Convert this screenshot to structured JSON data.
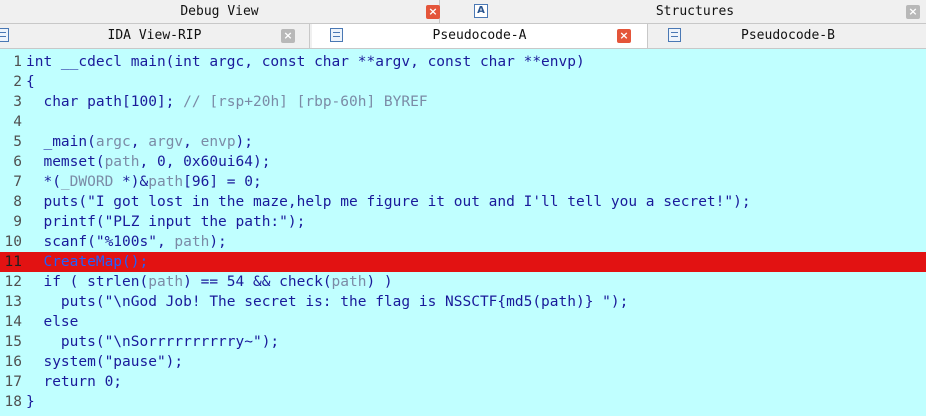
{
  "tabs_top": [
    {
      "label": "Debug View",
      "active": false
    },
    {
      "label": "Structures",
      "active": false
    }
  ],
  "tabs_bottom": [
    {
      "label": "IDA View-RIP",
      "active": false
    },
    {
      "label": "Pseudocode-A",
      "active": true
    },
    {
      "label": "Pseudocode-B",
      "active": false
    }
  ],
  "breakpoint_line": 11,
  "colors": {
    "background": "#c0ffff",
    "breakpoint": "#e21212",
    "code": "#1a1a9a",
    "variable": "#7b8ba6"
  },
  "code_lines": [
    [
      [
        "int __cdecl main(int argc, const char **argv, const char **envp)",
        "c"
      ]
    ],
    [
      [
        "{",
        "c"
      ]
    ],
    [
      [
        "  char path[100]; ",
        "c"
      ],
      [
        "// [rsp+20h] [rbp-60h] BYREF",
        "m"
      ]
    ],
    [
      [
        "",
        "c"
      ]
    ],
    [
      [
        "  _main(",
        "c"
      ],
      [
        "argc",
        "v"
      ],
      [
        ", ",
        "c"
      ],
      [
        "argv",
        "v"
      ],
      [
        ", ",
        "c"
      ],
      [
        "envp",
        "v"
      ],
      [
        ");",
        "c"
      ]
    ],
    [
      [
        "  memset(",
        "c"
      ],
      [
        "path",
        "v"
      ],
      [
        ", 0, 0x60ui64);",
        "c"
      ]
    ],
    [
      [
        "  *(",
        "c"
      ],
      [
        "_DWORD",
        "v"
      ],
      [
        " *)&",
        "c"
      ],
      [
        "path",
        "v"
      ],
      [
        "[96] = 0;",
        "c"
      ]
    ],
    [
      [
        "  puts(\"I got lost in the maze,help me figure it out and I'll tell you a secret!\");",
        "c"
      ]
    ],
    [
      [
        "  printf(\"PLZ input the path:\");",
        "c"
      ]
    ],
    [
      [
        "  scanf(\"%100s\", ",
        "c"
      ],
      [
        "path",
        "v"
      ],
      [
        ");",
        "c"
      ]
    ],
    [
      [
        "  CreateMap();",
        "c"
      ]
    ],
    [
      [
        "  if ( strlen(",
        "c"
      ],
      [
        "path",
        "v"
      ],
      [
        ") == 54 && check(",
        "c"
      ],
      [
        "path",
        "v"
      ],
      [
        ") )",
        "c"
      ]
    ],
    [
      [
        "    puts(\"\\nGod Job! The secret is: the flag is NSSCTF{md5(path)} \");",
        "c"
      ]
    ],
    [
      [
        "  else",
        "c"
      ]
    ],
    [
      [
        "    puts(\"\\nSorrrrrrrrrry~\");",
        "c"
      ]
    ],
    [
      [
        "  system(\"pause\");",
        "c"
      ]
    ],
    [
      [
        "  return 0;",
        "c"
      ]
    ],
    [
      [
        "}",
        "c"
      ]
    ]
  ]
}
